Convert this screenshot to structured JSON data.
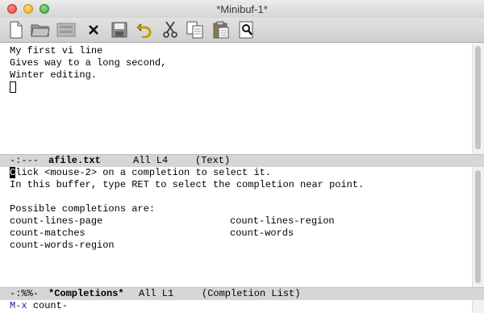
{
  "window": {
    "title": "*Minibuf-1*"
  },
  "toolbar": {
    "buttons": [
      {
        "name": "new-file-icon"
      },
      {
        "name": "open-folder-icon"
      },
      {
        "name": "dired-icon"
      },
      {
        "name": "close-buffer-icon"
      },
      {
        "name": "save-icon"
      },
      {
        "name": "undo-icon"
      },
      {
        "name": "cut-icon"
      },
      {
        "name": "copy-icon"
      },
      {
        "name": "paste-icon"
      },
      {
        "name": "search-icon"
      }
    ]
  },
  "buffer": {
    "lines": [
      "My first vi line",
      "Gives way to a long second,",
      "Winter editing."
    ]
  },
  "modeline1": {
    "status": "-:---",
    "buffer_name": "afile.txt",
    "position": "All L4",
    "mode": "(Text)"
  },
  "completions": {
    "help1": "lick <mouse-2> on a completion to select it.",
    "help1_first": "C",
    "help2": "In this buffer, type RET to select the completion near point.",
    "heading": "Possible completions are:",
    "items": [
      [
        "count-lines-page",
        "count-lines-region"
      ],
      [
        "count-matches",
        "count-words"
      ],
      [
        "count-words-region",
        ""
      ]
    ]
  },
  "modeline2": {
    "status": "-:%%-",
    "buffer_name": "*Completions*",
    "position": "All L1",
    "mode": "(Completion List)"
  },
  "minibuffer": {
    "prompt": "M-x",
    "input": "count-"
  }
}
